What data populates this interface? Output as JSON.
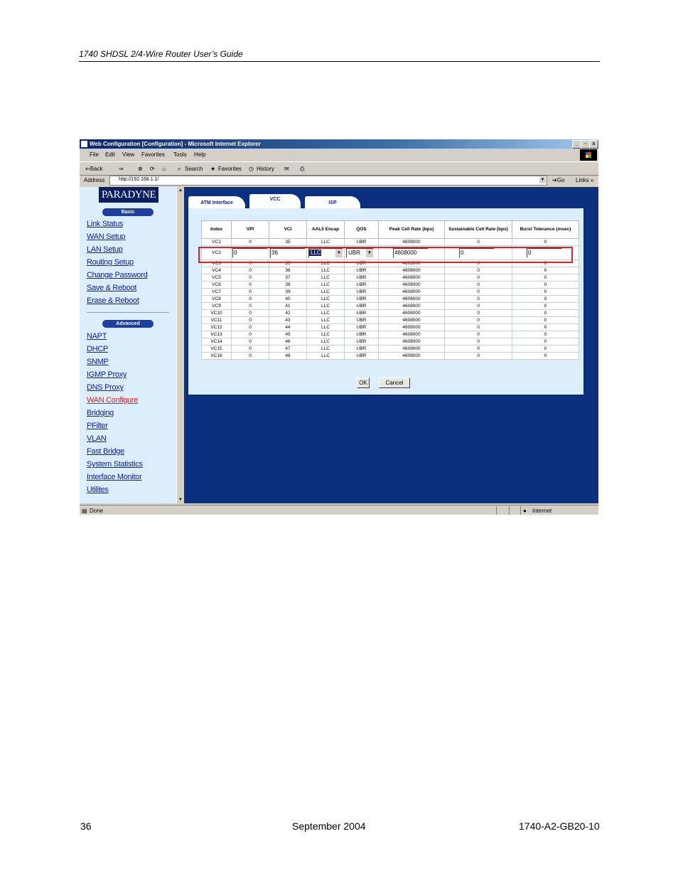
{
  "document": {
    "header": "1740 SHDSL 2/4-Wire Router User’s Guide",
    "footer_page": "36",
    "footer_date": "September 2004",
    "footer_docnum": "1740-A2-GB20-10"
  },
  "browser": {
    "title": "Web Configuration [Configuration] - Microsoft Internet Explorer",
    "window_buttons": [
      "_",
      "▫",
      "x"
    ],
    "menu": [
      "File",
      "Edit",
      "View",
      "Favorites",
      "Tools",
      "Help"
    ],
    "toolbar": {
      "back": "⇐Back",
      "forward": "⇒",
      "search": "Search",
      "favorites": "Favorites",
      "history": "History"
    },
    "address_label": "Address",
    "address_value": "http://192.168.1.1/",
    "go_label": "Go",
    "links_label": "Links »",
    "status_text": "Done",
    "zone_text": "Internet"
  },
  "sidebar": {
    "logo": "PARADYNE",
    "basic_label": "Basic",
    "basic_links": [
      "Link Status",
      "WAN Setup",
      "LAN Setup",
      "Routing Setup",
      "Change Password",
      "Save & Reboot",
      "Erase & Reboot"
    ],
    "advanced_label": "Advanced",
    "advanced_links": [
      "NAPT",
      "DHCP",
      "SNMP",
      "IGMP Proxy",
      "DNS Proxy",
      "WAN Configure",
      "Bridging",
      "PFilter",
      "VLAN",
      "Fast Bridge",
      "System Statistics",
      "Interface Monitor",
      "Utilites"
    ],
    "active_link": "WAN Configure"
  },
  "tabs": [
    "ATM Interface",
    "VCC",
    "ISP"
  ],
  "active_tab": "VCC",
  "vcc_table": {
    "headers": [
      "Index",
      "VPI",
      "VCI",
      "AAL5 Encap",
      "QOS",
      "Peak Cell Rate (bps)",
      "Sustainable Cell Rate (bps)",
      "Burst Tolerance (msec)"
    ],
    "rows": [
      [
        "VC1",
        "0",
        "35",
        "LLC",
        "UBR",
        "4608000",
        "0",
        "0"
      ],
      [
        "VC2",
        "0",
        "36",
        "LLC",
        "UBR",
        "4608000",
        "0",
        "0"
      ],
      [
        "VC3",
        "0",
        "35",
        "LLC",
        "UBR",
        "4608000",
        "0",
        "0"
      ],
      [
        "VC4",
        "0",
        "36",
        "LLC",
        "UBR",
        "4608000",
        "0",
        "0"
      ],
      [
        "VC5",
        "0",
        "37",
        "LLC",
        "UBR",
        "4608000",
        "0",
        "0"
      ],
      [
        "VC6",
        "0",
        "38",
        "LLC",
        "UBR",
        "4608000",
        "0",
        "0"
      ],
      [
        "VC7",
        "0",
        "39",
        "LLC",
        "UBR",
        "4608000",
        "0",
        "0"
      ],
      [
        "VC8",
        "0",
        "40",
        "LLC",
        "UBR",
        "4608000",
        "0",
        "0"
      ],
      [
        "VC9",
        "0",
        "41",
        "LLC",
        "UBR",
        "4608000",
        "0",
        "0"
      ],
      [
        "VC10",
        "0",
        "42",
        "LLC",
        "UBR",
        "4608000",
        "0",
        "0"
      ],
      [
        "VC11",
        "0",
        "43",
        "LLC",
        "UBR",
        "4608000",
        "0",
        "0"
      ],
      [
        "VC12",
        "0",
        "44",
        "LLC",
        "UBR",
        "4608000",
        "0",
        "0"
      ],
      [
        "VC13",
        "0",
        "45",
        "LLC",
        "UBR",
        "4608000",
        "0",
        "0"
      ],
      [
        "VC14",
        "0",
        "46",
        "LLC",
        "UBR",
        "4608000",
        "0",
        "0"
      ],
      [
        "VC15",
        "0",
        "47",
        "LLC",
        "UBR",
        "4608000",
        "0",
        "0"
      ],
      [
        "VC16",
        "0",
        "48",
        "LLC",
        "UBR",
        "4608000",
        "0",
        "0"
      ]
    ],
    "editing_row": 1
  },
  "buttons": {
    "ok": "OK",
    "cancel": "Cancel"
  },
  "colors": {
    "highlight": "#e3202a",
    "main_bg": "#0b2f7f",
    "link": "#0a1ca8",
    "active_link": "#e01a1a"
  }
}
